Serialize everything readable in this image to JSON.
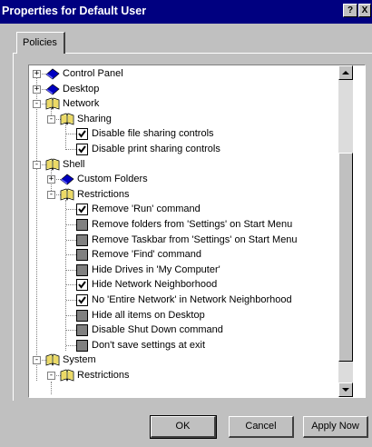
{
  "window": {
    "title": "Properties for Default User",
    "help_glyph": "?",
    "close_glyph": "X"
  },
  "tabs": [
    {
      "label": "Policies"
    }
  ],
  "tree": [
    {
      "label": "Control Panel",
      "type": "category",
      "icon": "book-blue-icon",
      "expander": "+"
    },
    {
      "label": "Desktop",
      "type": "category",
      "icon": "book-blue-icon",
      "expander": "+"
    },
    {
      "label": "Network",
      "type": "category",
      "icon": "book-open-icon",
      "expander": "-"
    },
    {
      "label": "Sharing",
      "type": "category",
      "icon": "book-open-icon",
      "expander": "-"
    },
    {
      "label": "Disable file sharing controls",
      "type": "policy",
      "checked": true
    },
    {
      "label": "Disable print sharing controls",
      "type": "policy",
      "checked": true
    },
    {
      "label": "Shell",
      "type": "category",
      "icon": "book-open-icon",
      "expander": "-"
    },
    {
      "label": "Custom Folders",
      "type": "category",
      "icon": "book-blue-icon",
      "expander": "+"
    },
    {
      "label": "Restrictions",
      "type": "category",
      "icon": "book-open-icon",
      "expander": "-"
    },
    {
      "label": "Remove 'Run' command",
      "type": "policy",
      "checked": true
    },
    {
      "label": "Remove folders from 'Settings' on Start Menu",
      "type": "policy",
      "checked": false
    },
    {
      "label": "Remove Taskbar from 'Settings' on Start Menu",
      "type": "policy",
      "checked": false
    },
    {
      "label": "Remove 'Find' command",
      "type": "policy",
      "checked": false
    },
    {
      "label": "Hide Drives in 'My Computer'",
      "type": "policy",
      "checked": false
    },
    {
      "label": "Hide Network Neighborhood",
      "type": "policy",
      "checked": true
    },
    {
      "label": "No 'Entire Network' in Network Neighborhood",
      "type": "policy",
      "checked": true
    },
    {
      "label": "Hide all items on Desktop",
      "type": "policy",
      "checked": false
    },
    {
      "label": "Disable Shut Down command",
      "type": "policy",
      "checked": false
    },
    {
      "label": "Don't save settings at exit",
      "type": "policy",
      "checked": false
    },
    {
      "label": "System",
      "type": "category",
      "icon": "book-open-icon",
      "expander": "-"
    },
    {
      "label": "Restrictions",
      "type": "category",
      "icon": "book-open-icon",
      "expander": "-"
    }
  ],
  "buttons": {
    "ok": "OK",
    "cancel": "Cancel",
    "apply": "Apply Now"
  },
  "colors": {
    "titlebar": "#000080",
    "face": "#c0c0c0",
    "book_blue": "#0000c0"
  }
}
